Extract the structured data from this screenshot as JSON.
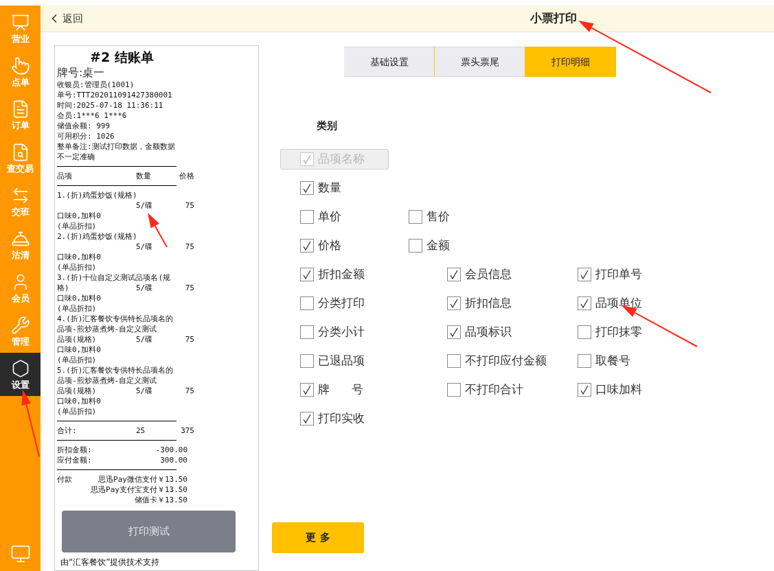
{
  "sidebar": {
    "items": [
      {
        "label": "营业",
        "selected": false
      },
      {
        "label": "点单",
        "selected": false
      },
      {
        "label": "订单",
        "selected": false
      },
      {
        "label": "查交易",
        "selected": false
      },
      {
        "label": "交班",
        "selected": false
      },
      {
        "label": "沽清",
        "selected": false
      },
      {
        "label": "会员",
        "selected": false
      },
      {
        "label": "管理",
        "selected": false
      },
      {
        "label": "设置",
        "selected": true
      }
    ]
  },
  "header": {
    "back": "返回",
    "title": "小票打印"
  },
  "receipt": {
    "lines": [
      {
        "kind": "title",
        "text": "#2 结账单"
      },
      {
        "kind": "table_no",
        "text": "牌号:桌一"
      },
      {
        "kind": "text",
        "text": "收银员:管理员(1001)"
      },
      {
        "kind": "text",
        "text": "单号:TTT202011091427380001"
      },
      {
        "kind": "text",
        "text": "时间:2025-07-18 11:36:11"
      },
      {
        "kind": "text",
        "text": "会员:1***6  1***6"
      },
      {
        "kind": "text",
        "text": "储值余额: 999"
      },
      {
        "kind": "text",
        "text": "可用积分: 1026"
      },
      {
        "kind": "text",
        "text": "整单备注:测试打印数据，金额数据不一定准确"
      },
      {
        "kind": "rule"
      },
      {
        "kind": "cols",
        "cells": [
          "品项",
          "数量",
          "价格"
        ]
      },
      {
        "kind": "rule"
      },
      {
        "kind": "text",
        "text": "1.(折)鸡蛋炒饭(规格)"
      },
      {
        "kind": "cols",
        "cells": [
          "",
          "5/碟",
          "75"
        ]
      },
      {
        "kind": "text",
        "text": "口味0,加料0"
      },
      {
        "kind": "text",
        "text": "(单品折扣)"
      },
      {
        "kind": "text",
        "text": "2.(折)鸡蛋炒饭(规格)"
      },
      {
        "kind": "cols",
        "cells": [
          "",
          "5/碟",
          "75"
        ]
      },
      {
        "kind": "text",
        "text": "口味0,加料0"
      },
      {
        "kind": "text",
        "text": "(单品折扣)"
      },
      {
        "kind": "text",
        "text": "3.(折)十位自定义测试品项名(规"
      },
      {
        "kind": "cols",
        "cells": [
          "格)",
          "5/碟",
          "75"
        ]
      },
      {
        "kind": "text",
        "text": "口味0,加料0"
      },
      {
        "kind": "text",
        "text": "(单品折扣)"
      },
      {
        "kind": "text",
        "text": "4.(折)汇客餐饮专供特长品项名的品项-煎炒蒸煮烤-自定义测试"
      },
      {
        "kind": "cols",
        "cells": [
          "品项(规格)",
          "5/碟",
          "75"
        ]
      },
      {
        "kind": "text",
        "text": "口味0,加料0"
      },
      {
        "kind": "text",
        "text": "(单品折扣)"
      },
      {
        "kind": "text",
        "text": "5.(折)汇客餐饮专供特长品项名的品项-煎炒蒸煮烤-自定义测试"
      },
      {
        "kind": "cols",
        "cells": [
          "品项(规格)",
          "5/碟",
          "75"
        ]
      },
      {
        "kind": "text",
        "text": "口味0,加料0"
      },
      {
        "kind": "text",
        "text": "(单品折扣)"
      },
      {
        "kind": "rule"
      },
      {
        "kind": "cols",
        "cells": [
          "合计:",
          "25",
          "375"
        ]
      },
      {
        "kind": "rule"
      },
      {
        "kind": "amount",
        "cells": [
          "折扣金额:",
          "-300.00"
        ]
      },
      {
        "kind": "amount",
        "cells": [
          "应付金额:",
          "300.00"
        ]
      },
      {
        "kind": "rule"
      },
      {
        "kind": "amount",
        "cells": [
          "付款",
          "思迅Pay微信支付￥13.50"
        ]
      },
      {
        "kind": "right",
        "text": "思迅Pay支付宝支付￥13.50"
      },
      {
        "kind": "right",
        "text": "储值卡￥13.50"
      }
    ],
    "footer": "由“汇客餐饮”提供技术支持",
    "test_button": "打印测试"
  },
  "tabs": [
    {
      "label": "基础设置",
      "selected": false
    },
    {
      "label": "票头票尾",
      "selected": false
    },
    {
      "label": "打印明细",
      "selected": true
    }
  ],
  "section_title": "类别",
  "option_rows": [
    [
      {
        "label": "品项名称",
        "checked": true,
        "disabled": true
      }
    ],
    [
      {
        "label": "数量",
        "checked": true,
        "disabled": false
      }
    ],
    [
      {
        "label": "单价",
        "checked": false,
        "disabled": false
      },
      {
        "label": "售价",
        "checked": false,
        "disabled": false
      }
    ],
    [
      {
        "label": "价格",
        "checked": true,
        "disabled": false
      },
      {
        "label": "金额",
        "checked": false,
        "disabled": false
      }
    ],
    [
      {
        "label": "折扣金额",
        "checked": true,
        "disabled": false
      },
      {
        "label": "会员信息",
        "checked": true,
        "disabled": false
      },
      {
        "label": "打印单号",
        "checked": true,
        "disabled": false
      }
    ],
    [
      {
        "label": "分类打印",
        "checked": false,
        "disabled": false
      },
      {
        "label": "折扣信息",
        "checked": true,
        "disabled": false
      },
      {
        "label": "品项单位",
        "checked": true,
        "disabled": false
      }
    ],
    [
      {
        "label": "分类小计",
        "checked": false,
        "disabled": false
      },
      {
        "label": "品项标识",
        "checked": true,
        "disabled": false
      },
      {
        "label": "打印抹零",
        "checked": false,
        "disabled": false
      }
    ],
    [
      {
        "label": "已退品项",
        "checked": false,
        "disabled": false
      },
      {
        "label": "不打印应付金额",
        "checked": false,
        "disabled": false
      },
      {
        "label": "取餐号",
        "checked": false,
        "disabled": false
      }
    ],
    [
      {
        "label": "牌      号",
        "checked": true,
        "disabled": false
      },
      {
        "label": "不打印合计",
        "checked": false,
        "disabled": false
      },
      {
        "label": "口味加料",
        "checked": true,
        "disabled": false
      }
    ],
    [
      {
        "label": "打印实收",
        "checked": true,
        "disabled": false
      }
    ]
  ],
  "more_button": "更 多"
}
